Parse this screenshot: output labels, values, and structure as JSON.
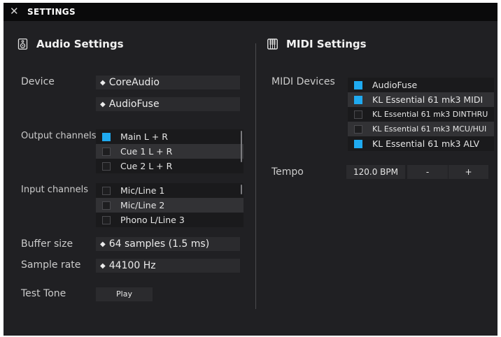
{
  "titlebar": {
    "close_glyph": "✕",
    "title": "SETTINGS"
  },
  "audio": {
    "heading": "Audio Settings",
    "icon": "speaker-icon",
    "device": {
      "label": "Device",
      "driver": "CoreAudio",
      "interface": "AudioFuse"
    },
    "output_channels": {
      "label": "Output channels",
      "items": [
        {
          "label": "Main L + R",
          "checked": true
        },
        {
          "label": "Cue 1 L + R",
          "checked": false
        },
        {
          "label": "Cue 2 L + R",
          "checked": false
        }
      ]
    },
    "input_channels": {
      "label": "Input channels",
      "items": [
        {
          "label": "Mic/Line 1",
          "checked": false
        },
        {
          "label": "Mic/Line 2",
          "checked": false
        },
        {
          "label": "Phono L/Line 3",
          "checked": false
        }
      ]
    },
    "buffer_size": {
      "label": "Buffer size",
      "value": "64 samples (1.5 ms)"
    },
    "sample_rate": {
      "label": "Sample rate",
      "value": "44100 Hz"
    },
    "test_tone": {
      "label": "Test Tone",
      "button": "Play"
    }
  },
  "midi": {
    "heading": "MIDI Settings",
    "icon": "piano-keys-icon",
    "devices": {
      "label": "MIDI Devices",
      "items": [
        {
          "label": "AudioFuse",
          "checked": true
        },
        {
          "label": "KL Essential 61 mk3 MIDI",
          "checked": true
        },
        {
          "label": "KL Essential 61 mk3 DINTHRU",
          "checked": false
        },
        {
          "label": "KL Essential 61 mk3 MCU/HUI",
          "checked": false
        },
        {
          "label": "KL Essential 61 mk3 ALV",
          "checked": true
        }
      ]
    },
    "tempo": {
      "label": "Tempo",
      "value": "120.0 BPM",
      "decrement": "-",
      "increment": "+"
    }
  },
  "colors": {
    "accent": "#1faaf0",
    "background": "#202023",
    "titlebar": "#0a0a0b"
  }
}
